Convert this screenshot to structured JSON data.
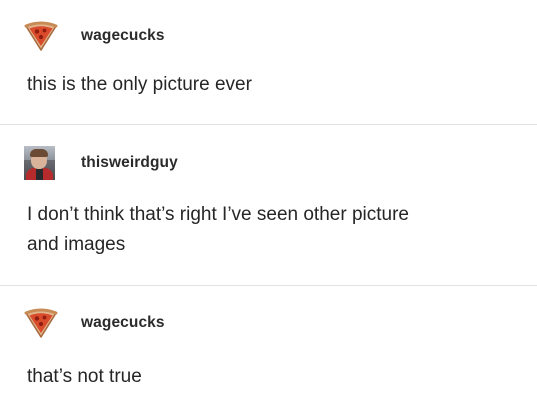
{
  "posts": [
    {
      "username": "wagecucks",
      "avatar_icon": "pizza-slice-icon",
      "text": "this is the only picture ever"
    },
    {
      "username": "thisweirdguy",
      "avatar_icon": "child-in-car-seat-photo",
      "text": "I don’t think that’s right I’ve seen other picture\nand images"
    },
    {
      "username": "wagecucks",
      "avatar_icon": "pizza-slice-icon",
      "text": "that’s not true"
    }
  ],
  "colors": {
    "background": "#ffffff",
    "divider": "#e2e2e2",
    "text": "#262626",
    "pizza_crust": "#e0b48c",
    "pizza_sauce": "#d94b2b"
  }
}
